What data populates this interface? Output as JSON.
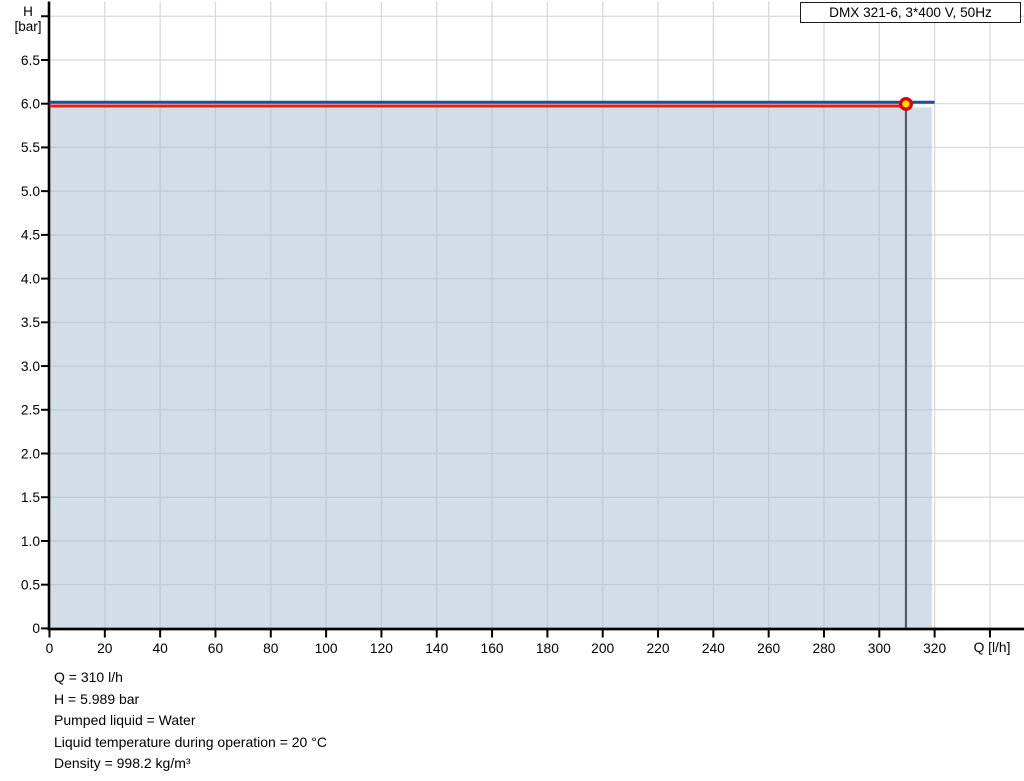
{
  "y_axis_title": {
    "line1": "H",
    "line2": "[bar]"
  },
  "legend": {
    "label": "DMX 321-6, 3*400 V, 50Hz"
  },
  "footer": {
    "lines": [
      "Q = 310 l/h",
      "H = 5.989 bar",
      "Pumped liquid = Water",
      "Liquid temperature during operation = 20 °C",
      "Density = 998.2 kg/m³"
    ]
  },
  "chart_data": {
    "type": "line",
    "title": "DMX 321-6, 3*400 V, 50Hz",
    "xlabel": "Q [l/h]",
    "ylabel": "H [bar]",
    "xlim": [
      0,
      352
    ],
    "ylim": [
      0,
      7.16
    ],
    "grid": true,
    "legend_position": "top-right",
    "x_tick_values": [
      0,
      20,
      40,
      60,
      80,
      100,
      120,
      140,
      160,
      180,
      200,
      220,
      240,
      260,
      280,
      300,
      320,
      340
    ],
    "x_tick_labels": [
      "0",
      "20",
      "40",
      "60",
      "80",
      "100",
      "120",
      "140",
      "160",
      "180",
      "200",
      "220",
      "240",
      "260",
      "280",
      "300",
      "320",
      ""
    ],
    "y_tick_values": [
      0,
      0.5,
      1.0,
      1.5,
      2.0,
      2.5,
      3.0,
      3.5,
      4.0,
      4.5,
      5.0,
      5.5,
      6.0,
      6.5,
      7.0
    ],
    "y_tick_labels": [
      "0",
      "0.5",
      "1.0",
      "1.5",
      "2.0",
      "2.5",
      "3.0",
      "3.5",
      "4.0",
      "4.5",
      "5.0",
      "5.5",
      "6.0",
      "6.5",
      ""
    ],
    "series": [
      {
        "name": "pump-curve",
        "color": "#1e4f96",
        "points": [
          {
            "q": 0,
            "h": 6.0
          },
          {
            "q": 320,
            "h": 6.0
          }
        ]
      },
      {
        "name": "operating-curve",
        "color": "#e5201c",
        "points": [
          {
            "q": 0,
            "h": 5.989
          },
          {
            "q": 310,
            "h": 5.989
          }
        ]
      }
    ],
    "area_fill": {
      "q_max": 319,
      "h_top": 5.989,
      "color": "rgba(166,188,210,0.5)"
    },
    "operating_point": {
      "q": 310,
      "h": 5.989,
      "marker_fill": "#ffe600",
      "marker_stroke": "#e30000",
      "drop_line_color": "#4e5d69"
    },
    "colors": {
      "grid": "#d7d7d7",
      "axis": "#000000"
    }
  }
}
